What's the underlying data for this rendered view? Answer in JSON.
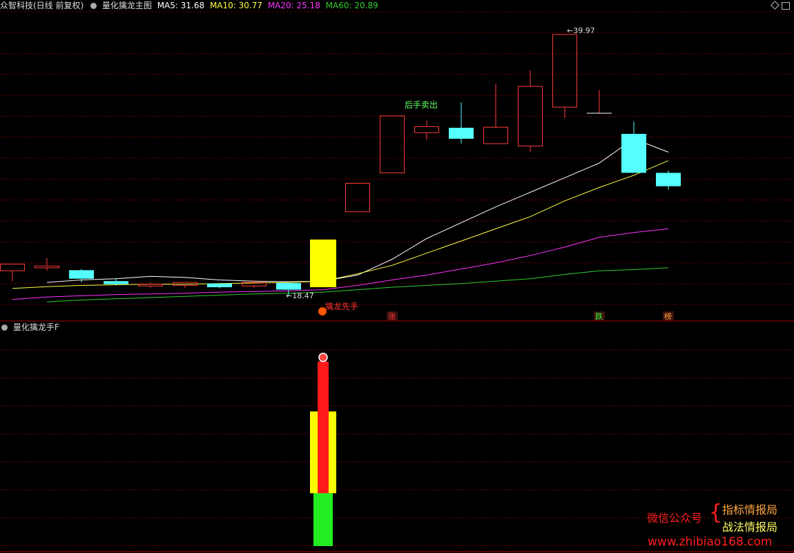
{
  "header": {
    "stock": "众智科技(日线 前复权)",
    "indicator": "量化擒龙主图",
    "ma5": "MA5: 31.68",
    "ma10": "MA10: 30.77",
    "ma20": "MA20: 25.18",
    "ma60": "MA60: 20.89"
  },
  "sub_header": {
    "indicator": "量化擒龙手F"
  },
  "colors": {
    "up": "#ff3b3b",
    "down": "#55ffff",
    "ma5": "#ffffff",
    "ma10": "#ffff44",
    "ma20": "#ff33ff",
    "ma60": "#33cc33",
    "grid": "#7a0000",
    "signal": "#ffff00"
  },
  "chart_data": [
    {
      "type": "candlestick",
      "title": "量化擒龙主图",
      "ylim": [
        17.5,
        41.1
      ],
      "candles": [
        {
          "o": 20.55,
          "h": 21.1,
          "l": 19.7,
          "c": 21.1
        },
        {
          "o": 20.8,
          "h": 21.6,
          "l": 20.55,
          "c": 20.95
        },
        {
          "o": 20.6,
          "h": 20.7,
          "l": 19.6,
          "c": 19.9
        },
        {
          "o": 19.7,
          "h": 19.9,
          "l": 19.35,
          "c": 19.45
        },
        {
          "o": 19.3,
          "h": 19.6,
          "l": 19.15,
          "c": 19.45
        },
        {
          "o": 19.35,
          "h": 19.6,
          "l": 19.15,
          "c": 19.6
        },
        {
          "o": 19.5,
          "h": 19.5,
          "l": 19.1,
          "c": 19.2
        },
        {
          "o": 19.3,
          "h": 19.8,
          "l": 19.15,
          "c": 19.6
        },
        {
          "o": 19.55,
          "h": 19.55,
          "l": 18.47,
          "c": 19.0
        },
        {
          "o": 19.2,
          "h": 23.12,
          "l": 19.2,
          "c": 23.12
        },
        {
          "o": 25.4,
          "h": 27.74,
          "l": 25.4,
          "c": 27.74
        },
        {
          "o": 28.6,
          "h": 33.28,
          "l": 28.6,
          "c": 33.28
        },
        {
          "o": 31.9,
          "h": 32.9,
          "l": 31.3,
          "c": 32.4
        },
        {
          "o": 32.3,
          "h": 34.4,
          "l": 31.0,
          "c": 31.4
        },
        {
          "o": 31.0,
          "h": 35.9,
          "l": 31.0,
          "c": 32.35
        },
        {
          "o": 30.8,
          "h": 37.0,
          "l": 30.3,
          "c": 35.7
        },
        {
          "o": 34.0,
          "h": 39.97,
          "l": 33.1,
          "c": 39.97
        },
        {
          "o": 33.5,
          "h": 35.4,
          "l": 33.5,
          "c": 33.5
        },
        {
          "o": 31.8,
          "h": 32.8,
          "l": 28.6,
          "c": 28.6
        },
        {
          "o": 28.6,
          "h": 28.8,
          "l": 27.2,
          "c": 27.5
        }
      ],
      "series": [
        {
          "name": "MA5",
          "values": [
            null,
            19.6,
            19.8,
            19.9,
            20.1,
            20.0,
            19.8,
            19.7,
            19.65,
            19.7,
            20.2,
            21.5,
            23.2,
            24.5,
            25.8,
            27.0,
            28.2,
            29.4,
            31.4,
            30.3
          ]
        },
        {
          "name": "MA10",
          "values": [
            19.1,
            19.25,
            19.35,
            19.4,
            19.45,
            19.45,
            19.5,
            19.55,
            19.6,
            19.7,
            20.3,
            21.0,
            22.0,
            23.0,
            24.0,
            25.0,
            26.3,
            27.4,
            28.4,
            29.6
          ]
        },
        {
          "name": "MA20",
          "values": [
            18.2,
            18.4,
            18.5,
            18.6,
            18.65,
            18.7,
            18.8,
            18.85,
            18.9,
            19.0,
            19.35,
            19.8,
            20.2,
            20.7,
            21.2,
            21.8,
            22.5,
            23.3,
            23.7,
            24.0
          ]
        },
        {
          "name": "MA60",
          "values": [
            null,
            18.0,
            18.15,
            18.25,
            18.35,
            18.45,
            18.55,
            18.65,
            18.7,
            18.8,
            19.0,
            19.2,
            19.35,
            19.5,
            19.7,
            19.9,
            20.25,
            20.55,
            20.65,
            20.8
          ]
        }
      ],
      "annotations": [
        {
          "text": "39.97",
          "index": 16,
          "value": 39.97,
          "kind": "high"
        },
        {
          "text": "18.47",
          "index": 8,
          "value": 18.47,
          "kind": "low"
        },
        {
          "text": "后手卖出",
          "index": 12,
          "value": 33.6
        },
        {
          "text": "擒龙先手",
          "index": 9,
          "value": 18.5
        }
      ],
      "bottom_labels": [
        {
          "text": "涨",
          "index": 11
        },
        {
          "text": "跌",
          "index": 17
        },
        {
          "text": "榜",
          "index": 19
        }
      ]
    },
    {
      "type": "bar",
      "title": "量化擒龙手F",
      "ylim": [
        0,
        100
      ],
      "bars": [
        {
          "index": 9,
          "color": "yellow",
          "from": 26.5,
          "to": 67.5
        },
        {
          "index": 9,
          "color": "red",
          "from": 26.5,
          "to": 92.5
        },
        {
          "index": 9,
          "color": "green",
          "from": 0,
          "to": 26.5
        }
      ]
    }
  ],
  "watermark": {
    "label": "微信公众号",
    "line1": "指标情报局",
    "line2": "战法情报局",
    "url": "www.zhibiao168.com"
  },
  "icons": [
    "chevron-circle-icon",
    "diamond-icon",
    "scroll-icon",
    "fire-icon"
  ]
}
